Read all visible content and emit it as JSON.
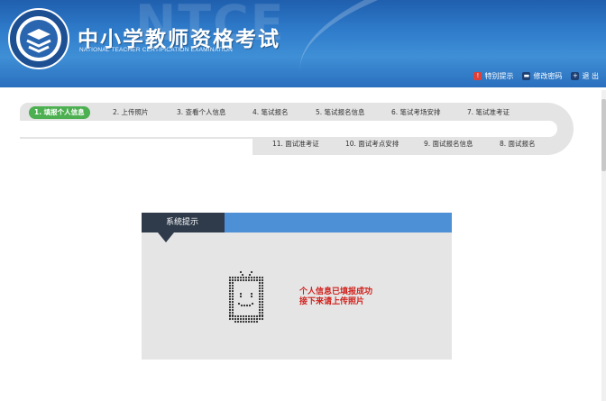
{
  "header": {
    "watermark": "NTCE",
    "title": "中小学教师资格考试",
    "subtitle": "NATIONAL TEACHER CERTIFICATION EXAMINATION",
    "links": [
      {
        "label": "特别提示",
        "icon": "warning-icon",
        "color": "#e0403a"
      },
      {
        "label": "修改密码",
        "icon": "password-icon",
        "color": "#1e3f73"
      },
      {
        "label": "退 出",
        "icon": "logout-icon",
        "color": "#1e3f73"
      }
    ]
  },
  "steps": [
    {
      "label": "1. 填报个人信息",
      "active": true
    },
    {
      "label": "2. 上传照片"
    },
    {
      "label": "3. 查看个人信息"
    },
    {
      "label": "4. 笔试报名"
    },
    {
      "label": "5. 笔试报名信息"
    },
    {
      "label": "6. 笔试考场安排"
    },
    {
      "label": "7. 笔试准考证"
    },
    {
      "label": "11. 面试准考证"
    },
    {
      "label": "10. 面试考点安排"
    },
    {
      "label": "9. 面试报名信息"
    },
    {
      "label": "8. 面试报名"
    }
  ],
  "notice": {
    "title": "系统提示",
    "line1": "个人信息已填报成功",
    "line2": "接下来请上传照片",
    "icon": "tv-smile-icon"
  },
  "colors": {
    "header_blue": "#2f7ccb",
    "active_step": "#4caf50",
    "notice_head": "#4d90d6",
    "notice_tab": "#2f3b4b",
    "message_red": "#d0211c"
  }
}
